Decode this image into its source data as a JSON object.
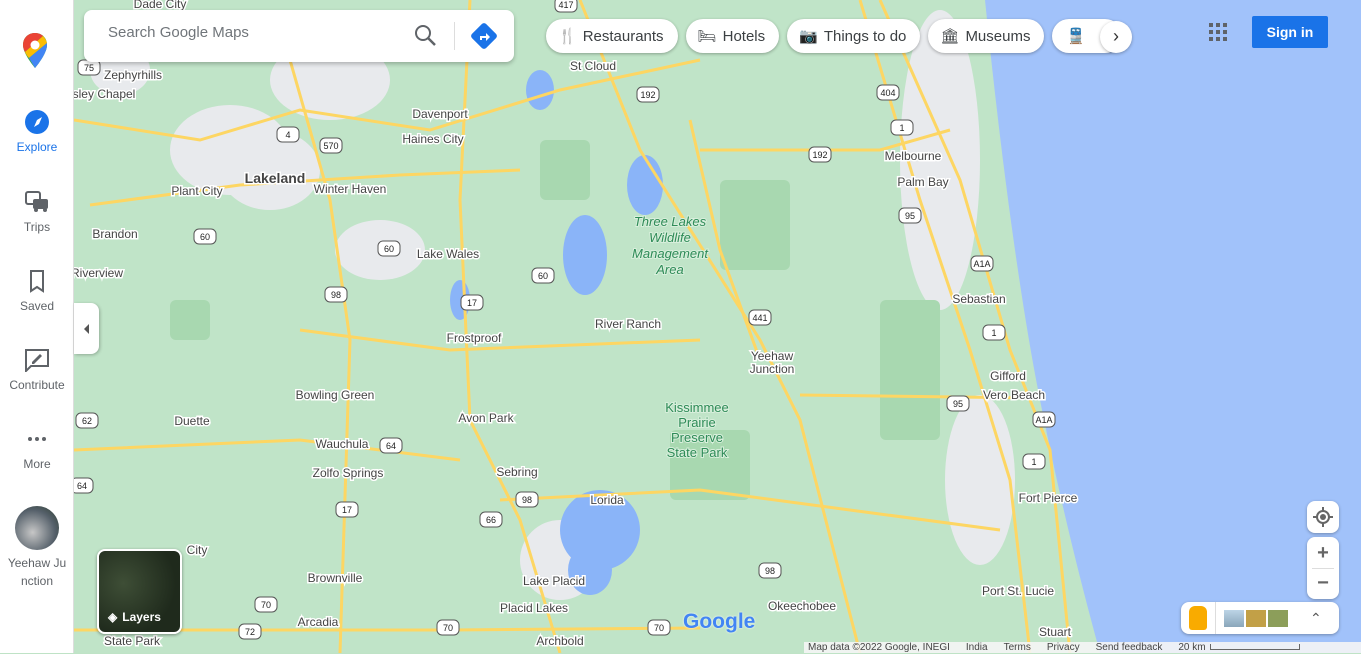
{
  "rail": {
    "items": [
      {
        "label": "Explore",
        "icon": "compass-icon",
        "active": true
      },
      {
        "label": "Trips",
        "icon": "trips-icon"
      },
      {
        "label": "Saved",
        "icon": "bookmark-icon"
      },
      {
        "label": "Contribute",
        "icon": "contribute-icon"
      },
      {
        "label": "More",
        "icon": "more-icon"
      }
    ],
    "recent": "Yeehaw Junction",
    "accent": "#1a73e8"
  },
  "search": {
    "placeholder": "Search Google Maps"
  },
  "chips": [
    {
      "label": "Restaurants",
      "icon": "fork-knife-icon"
    },
    {
      "label": "Hotels",
      "icon": "bed-icon"
    },
    {
      "label": "Things to do",
      "icon": "camera-icon"
    },
    {
      "label": "Museums",
      "icon": "museum-icon"
    },
    {
      "label": "",
      "icon": "transit-icon"
    }
  ],
  "header": {
    "signin": "Sign in"
  },
  "layers": {
    "label": "Layers"
  },
  "footer": {
    "map_data": "Map data ©2022 Google, INEGI",
    "region": "India",
    "terms": "Terms",
    "privacy": "Privacy",
    "feedback": "Send feedback",
    "scale": "20 km"
  },
  "logo": "Google",
  "map": {
    "places": [
      "Dade City",
      "Zephyrhills",
      "sley Chapel",
      "Plant City",
      "Lakeland",
      "Winter Haven",
      "Haines City",
      "Davenport",
      "St Cloud",
      "Brandon",
      "Riverview",
      "Lake Wales",
      "River Ranch",
      "Frostproof",
      "Melbourne",
      "Palm Bay",
      "Sebastian",
      "Yeehaw",
      "Junction",
      "Gifford",
      "Vero Beach",
      "Bowling Green",
      "Duette",
      "Avon Park",
      "Wauchula",
      "Zolfo Springs",
      "Sebring",
      "Lorida",
      "Fort Pierce",
      "City",
      "Brownville",
      "Lake Placid",
      "Okeechobee",
      "Placid Lakes",
      "Port St. Lucie",
      "Arcadia",
      "Archbold",
      "Stuart",
      "State Park"
    ],
    "parks": [
      "Three Lakes",
      "Wildlife",
      "Management",
      "Area",
      "Kissimmee",
      "Prairie",
      "Preserve",
      "State Park"
    ],
    "shields": [
      "75",
      "4",
      "570",
      "60",
      "60",
      "60",
      "98",
      "17",
      "441",
      "192",
      "192",
      "404",
      "1",
      "95",
      "A1A",
      "1",
      "95",
      "A1A",
      "1",
      "62",
      "64",
      "64",
      "17",
      "98",
      "66",
      "98",
      "70",
      "72",
      "70",
      "70",
      "417"
    ]
  }
}
